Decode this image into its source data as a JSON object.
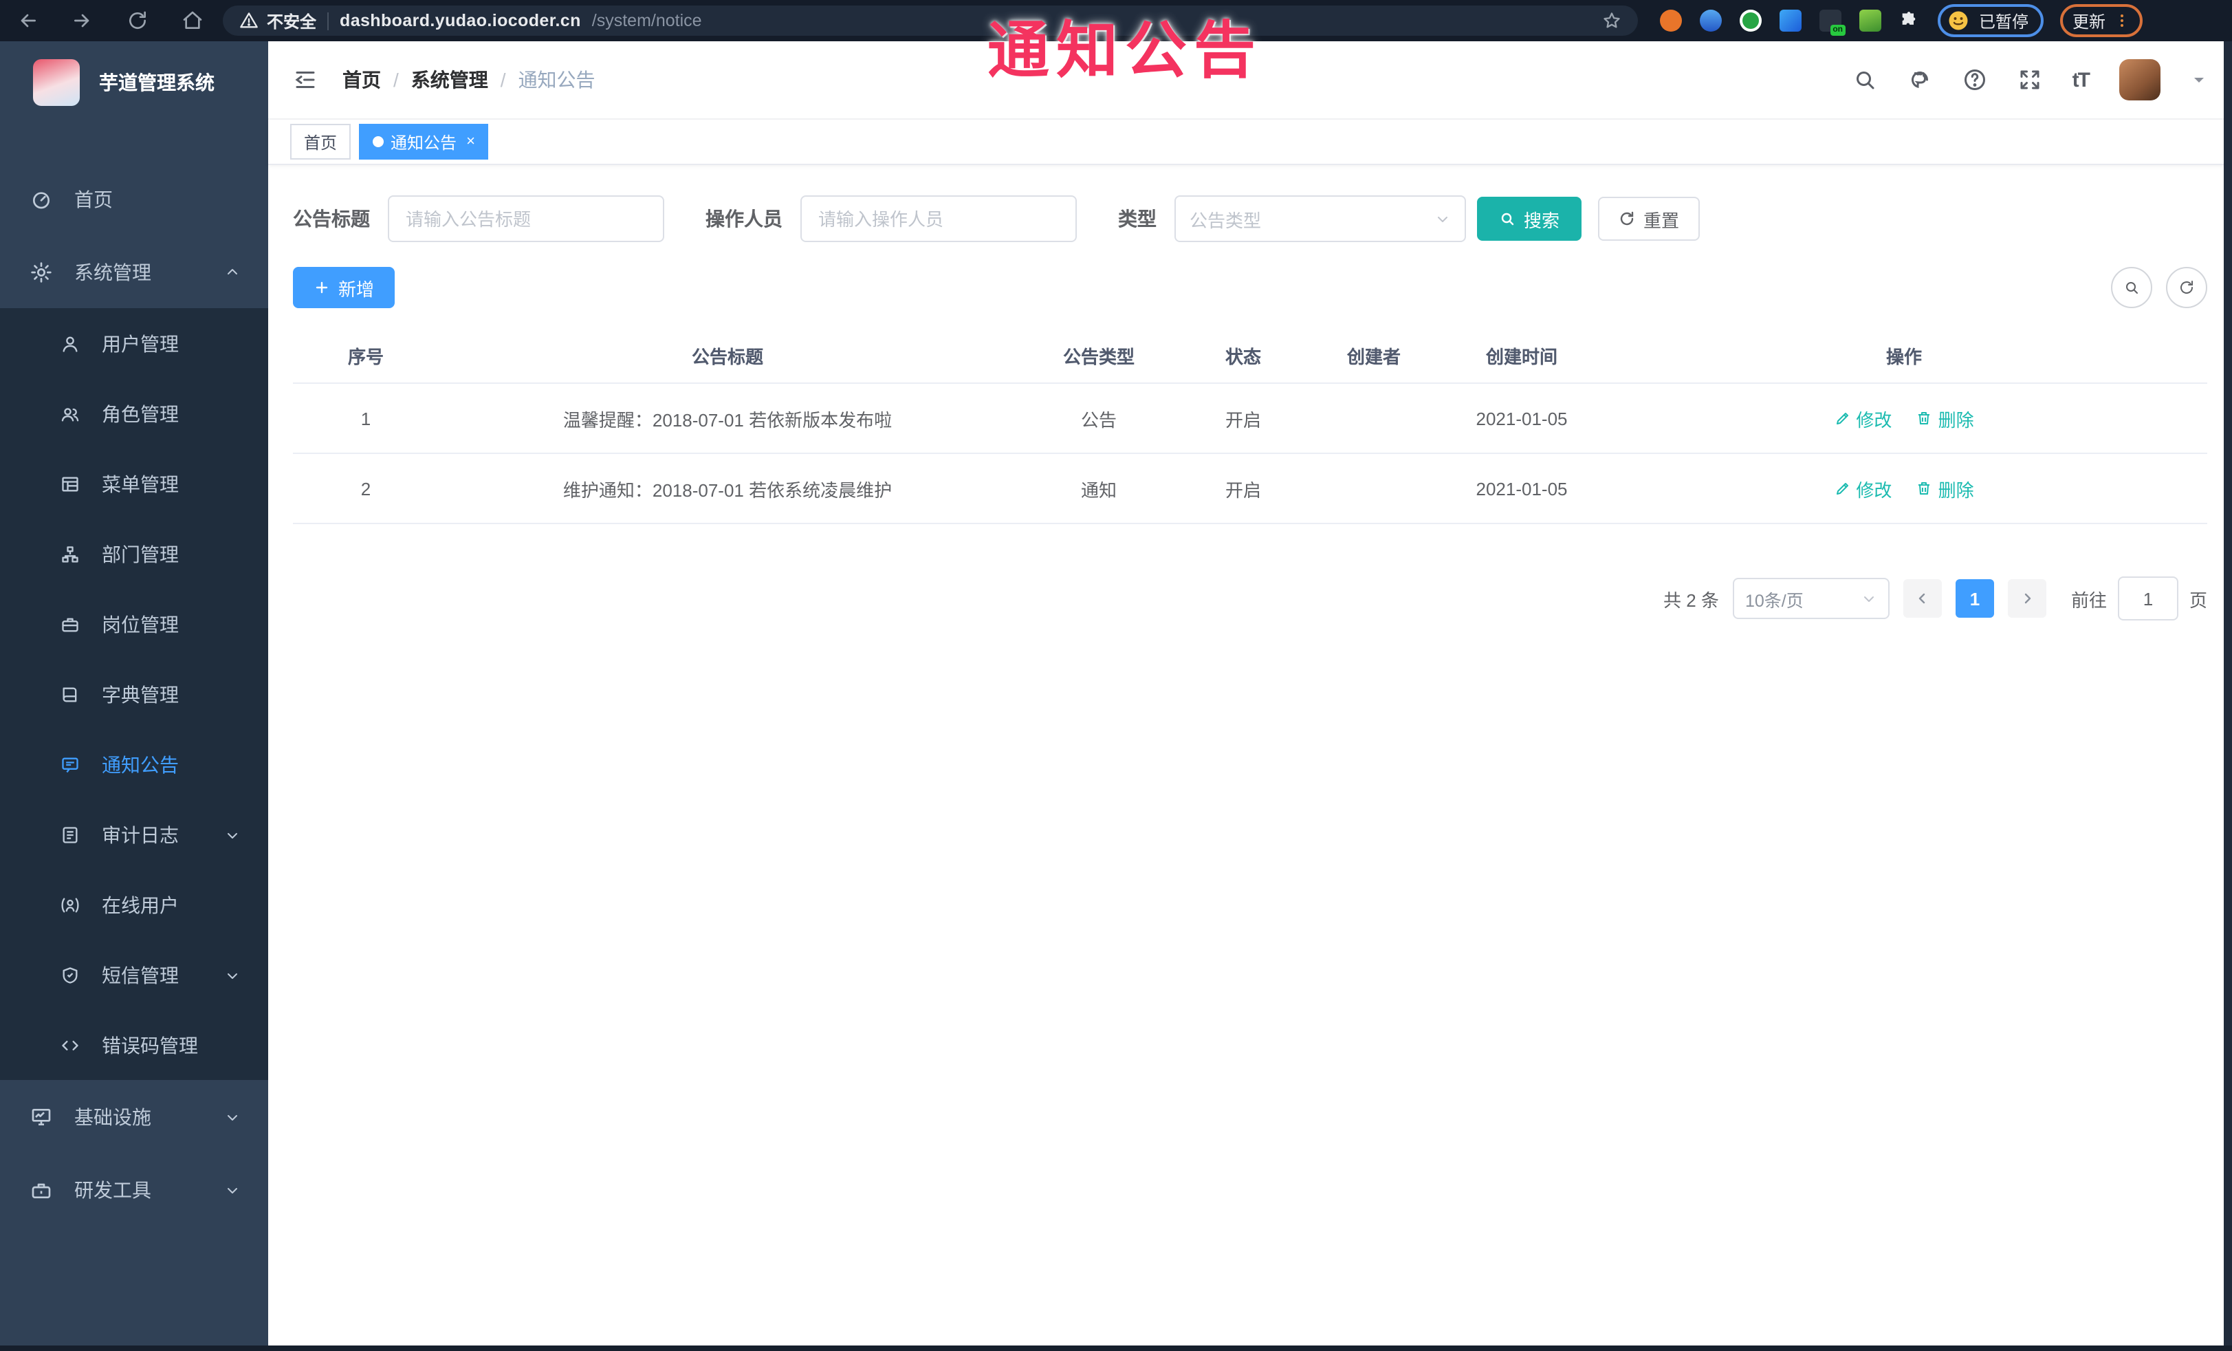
{
  "annotation": {
    "text": "通知公告"
  },
  "browser": {
    "security_label": "不安全",
    "url_host": "dashboard.yudao.iocoder.cn",
    "url_path": "/system/notice",
    "paused_label": "已暂停",
    "update_label": "更新",
    "extension_badge": "on"
  },
  "sidebar": {
    "logo_title": "芋道管理系统",
    "items": [
      {
        "label": "首页"
      },
      {
        "label": "系统管理"
      },
      {
        "label": "用户管理"
      },
      {
        "label": "角色管理"
      },
      {
        "label": "菜单管理"
      },
      {
        "label": "部门管理"
      },
      {
        "label": "岗位管理"
      },
      {
        "label": "字典管理"
      },
      {
        "label": "通知公告"
      },
      {
        "label": "审计日志"
      },
      {
        "label": "在线用户"
      },
      {
        "label": "短信管理"
      },
      {
        "label": "错误码管理"
      },
      {
        "label": "基础设施"
      },
      {
        "label": "研发工具"
      }
    ]
  },
  "header": {
    "breadcrumb": [
      {
        "label": "首页"
      },
      {
        "label": "系统管理"
      },
      {
        "label": "通知公告"
      }
    ]
  },
  "tags": {
    "items": [
      {
        "label": "首页"
      },
      {
        "label": "通知公告"
      }
    ]
  },
  "filters": {
    "title_label": "公告标题",
    "title_placeholder": "请输入公告标题",
    "operator_label": "操作人员",
    "operator_placeholder": "请输入操作人员",
    "type_label": "类型",
    "type_placeholder": "公告类型",
    "search_label": "搜索",
    "reset_label": "重置"
  },
  "toolbar": {
    "add_label": "新增"
  },
  "table": {
    "columns": [
      "序号",
      "公告标题",
      "公告类型",
      "状态",
      "创建者",
      "创建时间",
      "操作"
    ],
    "rows": [
      {
        "no": "1",
        "title": "温馨提醒：2018-07-01 若依新版本发布啦",
        "type": "公告",
        "status": "开启",
        "creator": "",
        "created": "2021-01-05",
        "edit": "修改",
        "delete": "删除"
      },
      {
        "no": "2",
        "title": "维护通知：2018-07-01 若依系统凌晨维护",
        "type": "通知",
        "status": "开启",
        "creator": "",
        "created": "2021-01-05",
        "edit": "修改",
        "delete": "删除"
      }
    ]
  },
  "pagination": {
    "total": "共 2 条",
    "page_size": "10条/页",
    "current": "1",
    "goto_label": "前往",
    "goto_value": "1",
    "goto_suffix": "页"
  },
  "colors": {
    "primary": "#409eff",
    "teal": "#1bb3aa",
    "action_teal": "#1cbbb0",
    "sidebar_bg": "#304156",
    "submenu_bg": "#1f2d3d",
    "annotation_red": "#f4335f"
  }
}
